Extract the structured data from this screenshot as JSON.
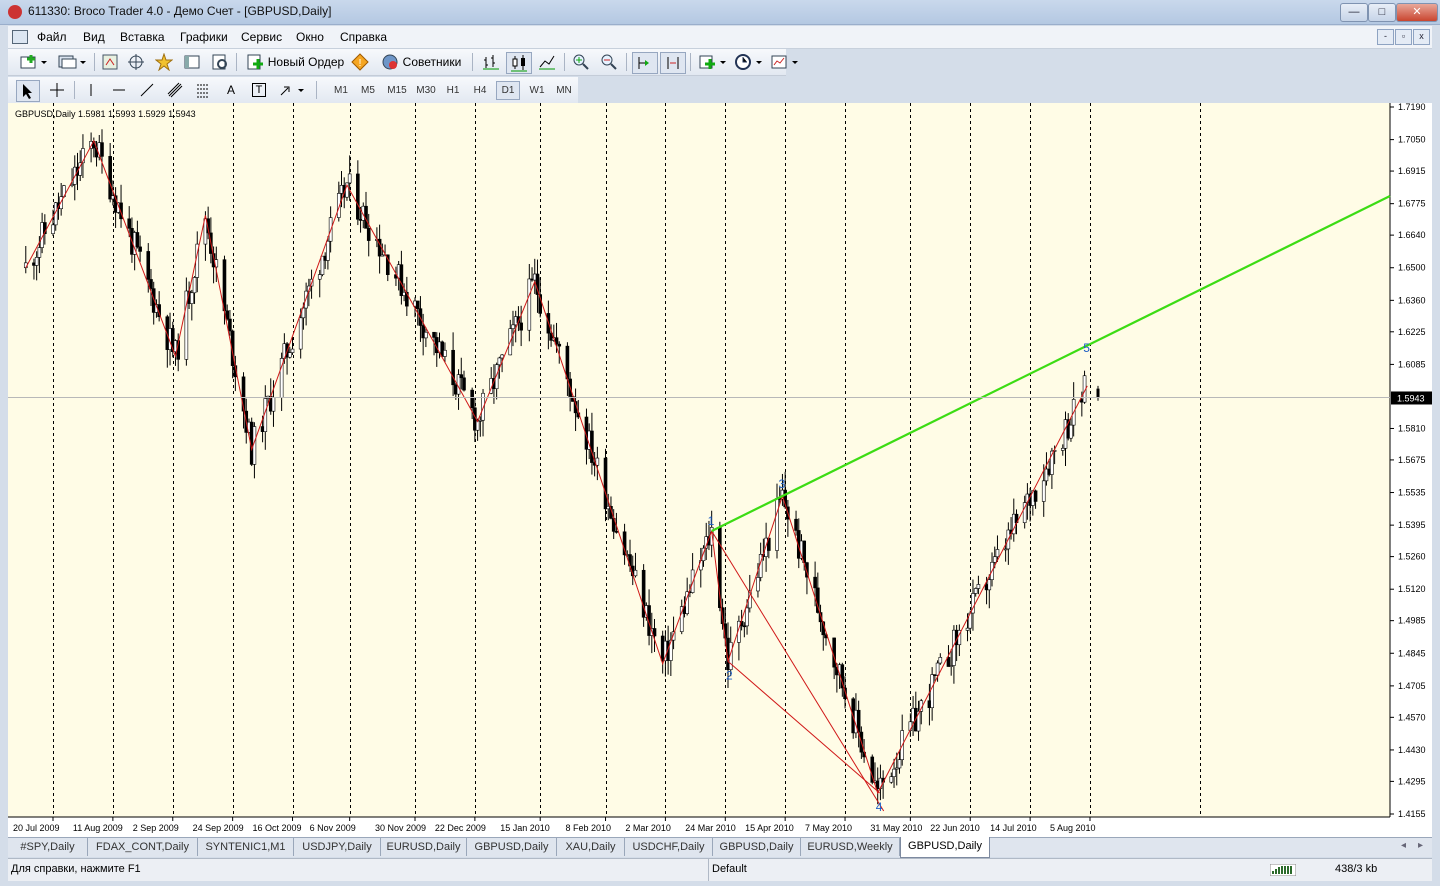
{
  "window": {
    "title": "611330: Broco Trader 4.0 - Демо Счет - [GBPUSD,Daily]",
    "minimize": "—",
    "maximize": "□",
    "close": "✕"
  },
  "menu": [
    "Файл",
    "Вид",
    "Вставка",
    "Графики",
    "Сервис",
    "Окно",
    "Справка"
  ],
  "mdi_controls": [
    "-",
    "▫",
    "x"
  ],
  "toolbar1": {
    "new_order": "Новый Ордер",
    "advisors": "Советники"
  },
  "toolbar2": {
    "text_tool": "A",
    "label_tool": "T",
    "timeframes": [
      "M1",
      "M5",
      "M15",
      "M30",
      "H1",
      "H4",
      "D1",
      "W1",
      "MN"
    ],
    "active_timeframe": "D1"
  },
  "chart": {
    "header": "GBPUSD,Daily  1.5981 1.5993 1.5929 1.5943",
    "current_price": "1.5943",
    "price_labels": [
      "1.7190",
      "1.7050",
      "1.6915",
      "1.6775",
      "1.6640",
      "1.6500",
      "1.6360",
      "1.6225",
      "1.6085",
      "1.5943",
      "1.5810",
      "1.5675",
      "1.5535",
      "1.5395",
      "1.5260",
      "1.5120",
      "1.4985",
      "1.4845",
      "1.4705",
      "1.4570",
      "1.4430",
      "1.4295",
      "1.4155"
    ],
    "date_labels": [
      "20 Jul 2009",
      "11 Aug 2009",
      "2 Sep 2009",
      "24 Sep 2009",
      "16 Oct 2009",
      "6 Nov 2009",
      "30 Nov 2009",
      "22 Dec 2009",
      "15 Jan 2010",
      "8 Feb 2010",
      "2 Mar 2010",
      "24 Mar 2010",
      "15 Apr 2010",
      "7 May 2010",
      "31 May 2010",
      "22 Jun 2010",
      "14 Jul 2010",
      "5 Aug 2010"
    ],
    "wave_labels": [
      "1",
      "2",
      "3",
      "4",
      "5"
    ],
    "colors": {
      "background": "#fffce6",
      "zigzag": "#d01818",
      "trendline": "#3cdc14",
      "candles": "#000000",
      "wave_labels": "#1f5fc4",
      "grid": "#000000"
    }
  },
  "chart_data": {
    "type": "candlestick",
    "symbol": "GBPUSD",
    "timeframe": "Daily",
    "ohlc_last": {
      "open": 1.5981,
      "high": 1.5993,
      "low": 1.5929,
      "close": 1.5943
    },
    "ylim": [
      1.4155,
      1.719
    ],
    "zigzag_pivots": [
      [
        "10 Jul 2009",
        1.65
      ],
      [
        "4 Aug 2009",
        1.7045
      ],
      [
        "3 Sep 2009",
        1.612
      ],
      [
        "14 Sep 2009",
        1.6725
      ],
      [
        "1 Oct 2009",
        1.572
      ],
      [
        "5 Nov 2009",
        1.6855
      ],
      [
        "23 Dec 2009",
        1.584
      ],
      [
        "13 Jan 2010",
        1.644
      ],
      [
        "1 Mar 2010",
        1.48
      ],
      [
        "19 Mar 2010",
        1.537
      ],
      [
        "25 Mar 2010",
        1.481
      ],
      [
        "14 Apr 2010",
        1.552
      ],
      [
        "19 May 2010",
        1.4245
      ],
      [
        "4 Aug 2010",
        1.5993
      ]
    ],
    "waves": [
      {
        "label": "1",
        "date": "19 Mar 2010",
        "price": 1.537
      },
      {
        "label": "2",
        "date": "25 Mar 2010",
        "price": 1.481
      },
      {
        "label": "3",
        "date": "14 Apr 2010",
        "price": 1.552
      },
      {
        "label": "4",
        "date": "19 May 2010",
        "price": 1.4245
      },
      {
        "label": "5",
        "date": "4 Aug 2010",
        "price": 1.5993
      }
    ],
    "trendline": {
      "from": [
        "19 Mar 2010",
        1.537
      ],
      "through": [
        "14 Apr 2010",
        1.552
      ]
    }
  },
  "tabs": [
    "#SPY,Daily",
    "FDAX_CONT,Daily",
    "SYNTENIC1,M1",
    "USDJPY,Daily",
    "EURUSD,Daily",
    "GBPUSD,Daily",
    "XAU,Daily",
    "USDCHF,Daily",
    "GBPUSD,Daily",
    "EURUSD,Weekly",
    "GBPUSD,Daily"
  ],
  "active_tab": 10,
  "status": {
    "help": "Для справки, нажмите F1",
    "profile": "Default",
    "traffic": "438/3 kb"
  }
}
